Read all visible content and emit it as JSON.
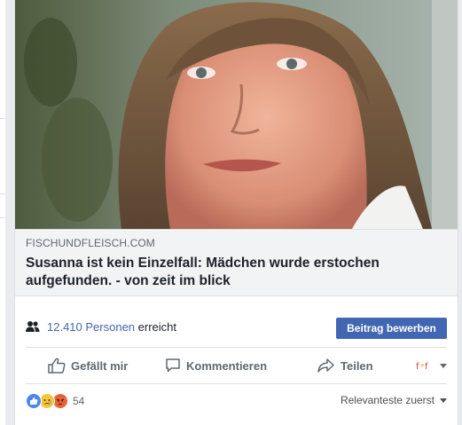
{
  "post": {
    "image_alt": "Portrait photo of a woman",
    "link": {
      "domain": "FISCHUNDFLEISCH.COM",
      "title": "Susanna ist kein Einzelfall: Mädchen wurde erstochen aufgefunden. - von zeit im blick"
    },
    "reach": {
      "count": "12.410",
      "unit": "Personen",
      "suffix": "erreicht",
      "icon": "people-icon"
    },
    "promote_button": "Beitrag bewerben",
    "actions": {
      "like": "Gefällt mir",
      "comment": "Kommentieren",
      "share": "Teilen"
    },
    "reactions": {
      "types": [
        "like",
        "sad",
        "angry"
      ],
      "count": "54"
    },
    "sort_label": "Relevanteste zuerst"
  },
  "colors": {
    "accent": "#4267b2",
    "background": "#e9ebee",
    "muted_text": "#606770"
  }
}
